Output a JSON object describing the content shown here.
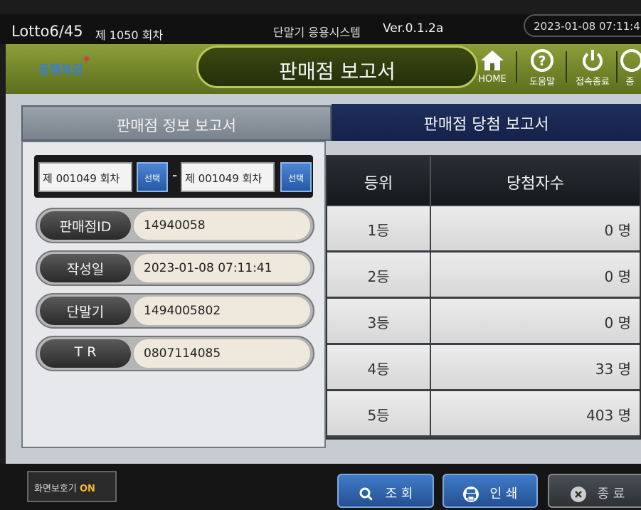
{
  "topbar": {
    "game": "Lotto6/45",
    "round": "제 1050 회차",
    "system": "단말기 응용시스템",
    "version": "Ver.0.1.2a",
    "datetime": "2023-01-08  07:11:4"
  },
  "header": {
    "logo": "동행복권",
    "title": "판매점 보고서",
    "buttons": {
      "home": "HOME",
      "help": "도움말",
      "logout": "접속종료",
      "extra": "종"
    }
  },
  "tabs": {
    "info": "판매점 정보 보고서",
    "winning": "판매점 당첨 보고서"
  },
  "round_range": {
    "from": "제 001049 회차",
    "to": "제 001049 회차",
    "select_label": "선택",
    "separator": "-"
  },
  "info_fields": [
    {
      "label": "판매점ID",
      "value": "14940058"
    },
    {
      "label": "작성일",
      "value": "2023-01-08  07:11:41"
    },
    {
      "label": "단말기",
      "value": "1494005802"
    },
    {
      "label": "T R",
      "value": "0807114085"
    }
  ],
  "results": {
    "header_rank": "등위",
    "header_count": "당첨자수",
    "rows": [
      {
        "rank": "1등",
        "count": "0 명"
      },
      {
        "rank": "2등",
        "count": "0 명"
      },
      {
        "rank": "3등",
        "count": "0 명"
      },
      {
        "rank": "4등",
        "count": "33 명"
      },
      {
        "rank": "5등",
        "count": "403 명"
      }
    ]
  },
  "footer": {
    "screensaver_label": "화면보호기",
    "screensaver_state": "ON",
    "search": "조 회",
    "print": "인 쇄",
    "exit": "종 료"
  },
  "colors": {
    "header_green": "#6f8226",
    "active_tab": "#1b2a55",
    "button_blue": "#2f66b0",
    "screensaver_on": "#f1b92a"
  }
}
